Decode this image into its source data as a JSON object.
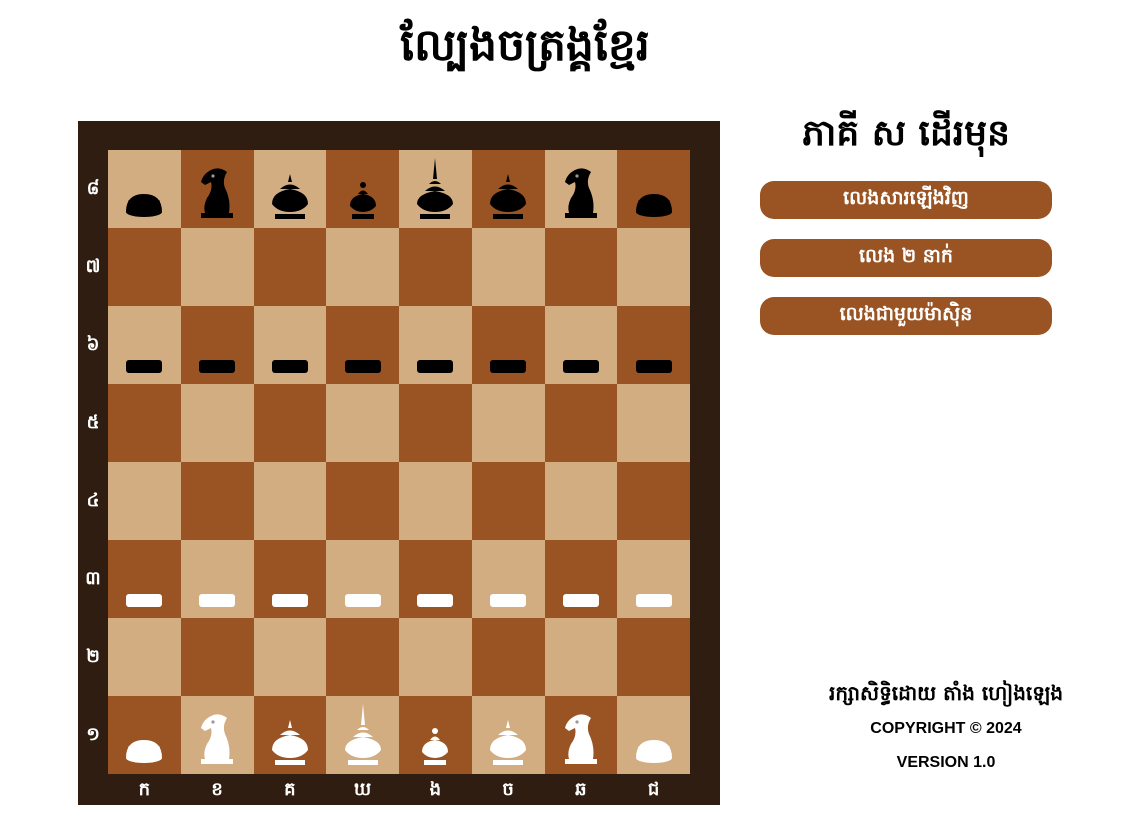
{
  "page": {
    "title": "ល្បែងចត្រង្គខ្មែរ"
  },
  "board": {
    "rank_labels": [
      "៨",
      "៧",
      "៦",
      "៥",
      "៤",
      "៣",
      "២",
      "១"
    ],
    "file_labels": [
      "ក",
      "ខ",
      "គ",
      "ឃ",
      "ង",
      "ច",
      "ឆ",
      "ជ"
    ],
    "light_color": "#d2ad82",
    "dark_color": "#9a5322",
    "frame_color": "#2f1d11",
    "position": [
      [
        "b-boat",
        "b-horse",
        "b-khon",
        "b-met",
        "b-king",
        "b-khon",
        "b-horse",
        "b-boat"
      ],
      [
        "",
        "",
        "",
        "",
        "",
        "",
        "",
        ""
      ],
      [
        "b-fish",
        "b-fish",
        "b-fish",
        "b-fish",
        "b-fish",
        "b-fish",
        "b-fish",
        "b-fish"
      ],
      [
        "",
        "",
        "",
        "",
        "",
        "",
        "",
        ""
      ],
      [
        "",
        "",
        "",
        "",
        "",
        "",
        "",
        ""
      ],
      [
        "w-fish",
        "w-fish",
        "w-fish",
        "w-fish",
        "w-fish",
        "w-fish",
        "w-fish",
        "w-fish"
      ],
      [
        "",
        "",
        "",
        "",
        "",
        "",
        "",
        ""
      ],
      [
        "w-boat",
        "w-horse",
        "w-khon",
        "w-king",
        "w-met",
        "w-khon",
        "w-horse",
        "w-boat"
      ]
    ]
  },
  "side": {
    "turn_text": "ភាគី ស ដើរមុន",
    "buttons": {
      "restart": "លេងសារឡើងវិញ",
      "two_player": "លេង ២ នាក់",
      "vs_computer": "លេងជាមួយម៉ាស៊ិន"
    },
    "accent_color": "#9a5322"
  },
  "footer": {
    "owner": "រក្សាសិទ្ធិដោយ តាំង ហៀងឡេង",
    "copyright": "COPYRIGHT © 2024",
    "version": "VERSION 1.0"
  }
}
